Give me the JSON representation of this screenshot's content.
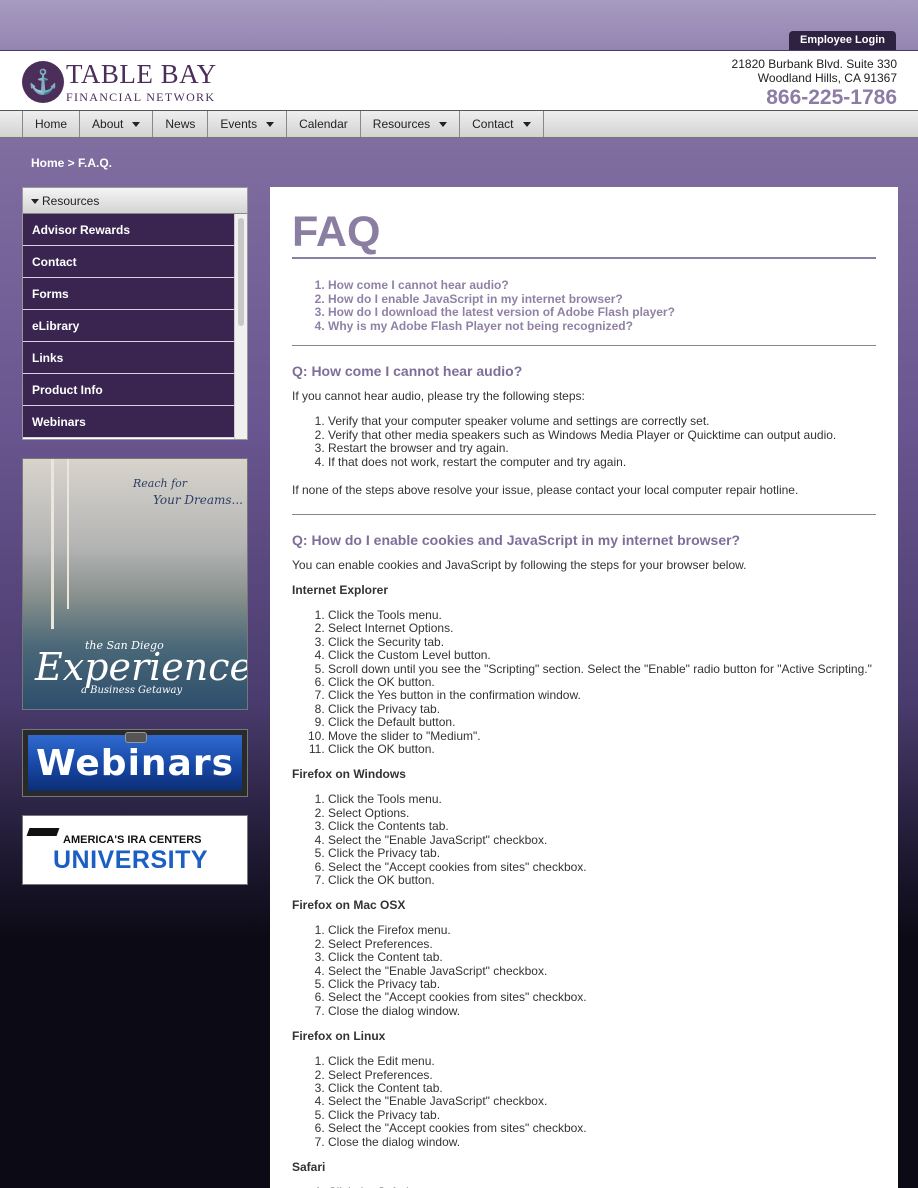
{
  "employee_login": "Employee Login",
  "logo": {
    "name": "TABLE BAY",
    "sub": "FINANCIAL NETWORK"
  },
  "address": {
    "line1": "21820 Burbank Blvd. Suite 330",
    "line2": "Woodland Hills, CA 91367",
    "phone": "866-225-1786"
  },
  "nav": [
    {
      "label": "Home",
      "dropdown": false
    },
    {
      "label": "About",
      "dropdown": true
    },
    {
      "label": "News",
      "dropdown": false
    },
    {
      "label": "Events",
      "dropdown": true
    },
    {
      "label": "Calendar",
      "dropdown": false
    },
    {
      "label": "Resources",
      "dropdown": true
    },
    {
      "label": "Contact",
      "dropdown": true
    }
  ],
  "breadcrumb": "Home  >  F.A.Q.",
  "sidebar": {
    "header": "Resources",
    "items": [
      "Advisor Rewards",
      "Contact",
      "Forms",
      "eLibrary",
      "Links",
      "Product Info",
      "Webinars"
    ]
  },
  "banners": {
    "sd_reach": "Reach for",
    "sd_dreams": "Your Dreams...",
    "sd_the": "the San Diego",
    "sd_experience": "Experience",
    "sd_getaway": "a Business Getaway",
    "webinars": "Webinars",
    "ira_top": "AMERICA'S IRA CENTERS",
    "ira_main": "UNIVERSITY"
  },
  "faq": {
    "title": "FAQ",
    "toc": [
      "How come I cannot hear audio?",
      "How do I enable JavaScript in my internet browser?",
      "How do I download the latest version of Adobe Flash player?",
      "Why is my Adobe Flash Player not being recognized?"
    ],
    "q1": {
      "heading": "Q: How come I cannot hear audio?",
      "intro": "If you cannot hear audio, please try the following steps:",
      "steps": [
        "Verify that your computer speaker volume and settings are correctly set.",
        "Verify that other media speakers such as Windows Media Player or Quicktime can output audio.",
        "Restart the browser and try again.",
        "If that does not work, restart the computer and try again."
      ],
      "outro": "If none of the steps above resolve your issue, please contact your local computer repair hotline."
    },
    "q2": {
      "heading": "Q: How do I enable cookies and JavaScript in my internet browser?",
      "intro": "You can enable cookies and JavaScript by following the steps for your browser below.",
      "browsers": [
        {
          "name": "Internet Explorer",
          "steps": [
            "Click the Tools menu.",
            "Select Internet Options.",
            "Click the Security tab.",
            "Click the Custom Level button.",
            "Scroll down until you see the \"Scripting\" section. Select the \"Enable\" radio button for \"Active Scripting.\"",
            "Click the OK button.",
            "Click the Yes button in the confirmation window.",
            "Click the Privacy tab.",
            "Click the Default button.",
            "Move the slider to \"Medium\".",
            "Click the OK button."
          ]
        },
        {
          "name": "Firefox on Windows",
          "steps": [
            "Click the Tools menu.",
            "Select Options.",
            "Click the Contents tab.",
            "Select the \"Enable JavaScript\" checkbox.",
            "Click the Privacy tab.",
            "Select the \"Accept cookies from sites\" checkbox.",
            "Click the OK button."
          ]
        },
        {
          "name": "Firefox on Mac OSX",
          "steps": [
            "Click the Firefox menu.",
            "Select Preferences.",
            "Click the Content tab.",
            "Select the \"Enable JavaScript\" checkbox.",
            "Click the Privacy tab.",
            "Select the \"Accept cookies from sites\" checkbox.",
            "Close the dialog window."
          ]
        },
        {
          "name": "Firefox on Linux",
          "steps": [
            "Click the Edit menu.",
            "Select Preferences.",
            "Click the Content tab.",
            "Select the \"Enable JavaScript\" checkbox.",
            "Click the Privacy tab.",
            "Select the \"Accept cookies from sites\" checkbox.",
            "Close the dialog window."
          ]
        },
        {
          "name": "Safari",
          "steps": [
            "Click the Safari menu."
          ]
        }
      ]
    }
  }
}
